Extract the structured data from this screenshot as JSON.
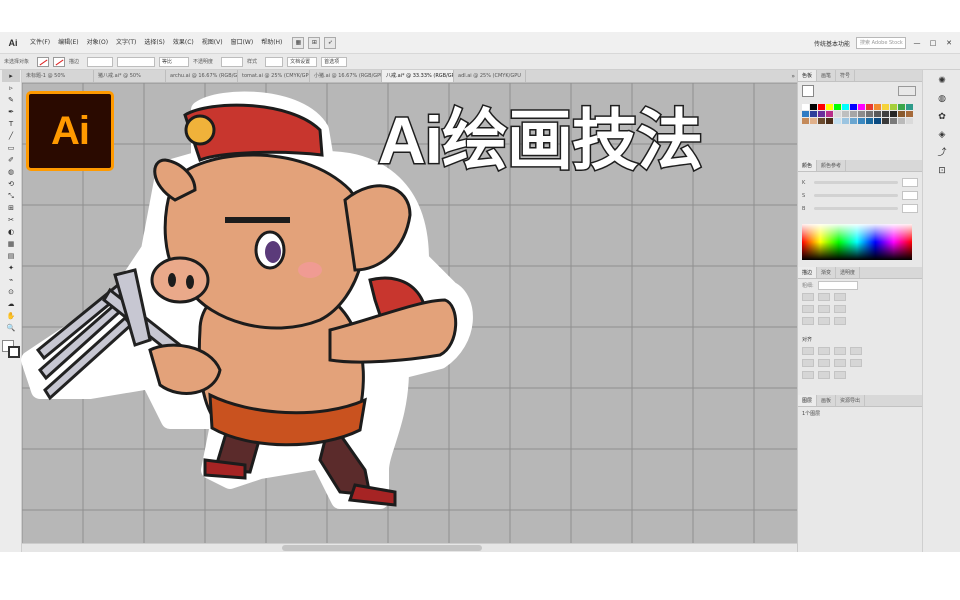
{
  "app": {
    "logo_text": "Ai",
    "menu": [
      "文件(F)",
      "编辑(E)",
      "对象(O)",
      "文字(T)",
      "选择(S)",
      "效果(C)",
      "视图(V)",
      "窗口(W)",
      "帮助(H)"
    ],
    "workspace_label": "传统基本功能",
    "search_placeholder": "搜索 Adobe Stock",
    "win_buttons": [
      "—",
      "□",
      "✕"
    ]
  },
  "control_bar": {
    "no_selection": "未选择对象",
    "stroke_label": "描边",
    "uniform_label": "等比",
    "opacity_label": "不透明度",
    "style_label": "样式",
    "doc_setup": "文档设置",
    "prefs": "首选项"
  },
  "tabs": [
    {
      "label": "未标题-1 @ 50%"
    },
    {
      "label": "猪八戒.ai* @ 50%"
    },
    {
      "label": "archu.ai @ 16.67% (RGB/GPU"
    },
    {
      "label": "tomat.ai @ 25% (CMYK/GPU"
    },
    {
      "label": "小猪.ai @ 16.67% (RGB/GPU"
    },
    {
      "label": "八戒.ai* @ 33.33% (RGB/GPU 预览)",
      "active": true
    },
    {
      "label": "adl.ai @ 25% (CMYK/GPU"
    }
  ],
  "tools": [
    "▸",
    "▹",
    "✎",
    "✒",
    "T",
    "╱",
    "▭",
    "✐",
    "◍",
    "⟲",
    "⤡",
    "⊞",
    "✂",
    "◐",
    "▦",
    "▤",
    "✦",
    "⌁",
    "⊙",
    "☁",
    "✋",
    "🔍"
  ],
  "panels": {
    "swatches_tabs": [
      "色板",
      "画笔",
      "符号"
    ],
    "color_tabs": [
      "颜色",
      "颜色参考"
    ],
    "color_sliders": [
      "K",
      "S",
      "B"
    ],
    "appearance_tabs": [
      "描边",
      "渐变",
      "透明度"
    ],
    "stroke_weight_label": "粗细:",
    "align_label": "对齐",
    "layers_tabs": [
      "图层",
      "画板",
      "资源导出"
    ],
    "layers_status": "1个图层"
  },
  "canvas": {
    "title_text": "Ai绘画技法",
    "badge_text": "Ai"
  },
  "colors": {
    "canvas_bg": "#b7b7b7",
    "grid_line": "#8f8f8f",
    "logo_bg": "#2a0a00",
    "logo_fg": "#ff9a00",
    "pig_skin": "#e3a27a",
    "hat_red": "#c8362e"
  }
}
